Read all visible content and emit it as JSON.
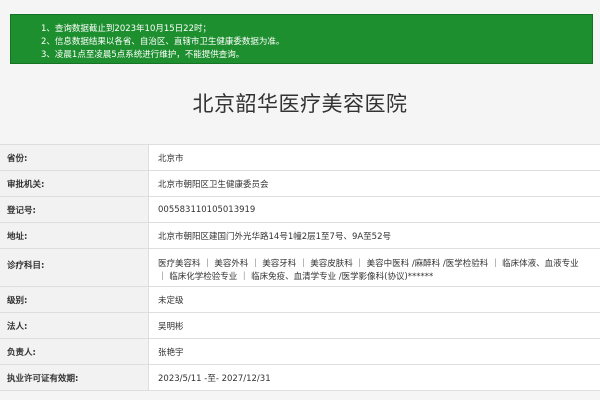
{
  "notice": {
    "lines": [
      "1、查询数据截止到2023年10月15日22时；",
      "2、信息数据结果以各省、自治区、直辖市卫生健康委数据为准。",
      "3、凌晨1点至凌晨5点系统进行维护，不能提供查询。"
    ]
  },
  "hospital_name": "北京韶华医疗美容医院",
  "info_table": {
    "province": {
      "label": "省份:",
      "value": "北京市"
    },
    "authority": {
      "label": "审批机关:",
      "value": "北京市朝阳区卫生健康委员会"
    },
    "registration_no": {
      "label": "登记号:",
      "value": "005583110105013919"
    },
    "address": {
      "label": "地址:",
      "value": "北京市朝阳区建国门外光华路14号1幢2层1至7号、9A至52号"
    },
    "departments": {
      "label": "诊疗科目:",
      "value": "医疗美容科 ｜ 美容外科 ｜ 美容牙科 ｜ 美容皮肤科 ｜ 美容中医科 /麻醉科 /医学检验科 ｜ 临床体液、血液专业 ｜ 临床化学检验专业 ｜ 临床免疫、血清学专业 /医学影像科(协议)******"
    },
    "grade": {
      "label": "级别:",
      "value": "未定级"
    },
    "legal_person": {
      "label": "法人:",
      "value": "吴明彬"
    },
    "person_in_charge": {
      "label": "负责人:",
      "value": "张艳宇"
    },
    "license_validity": {
      "label": "执业许可证有效期:",
      "value": "2023/5/11 -至- 2027/12/31"
    }
  }
}
